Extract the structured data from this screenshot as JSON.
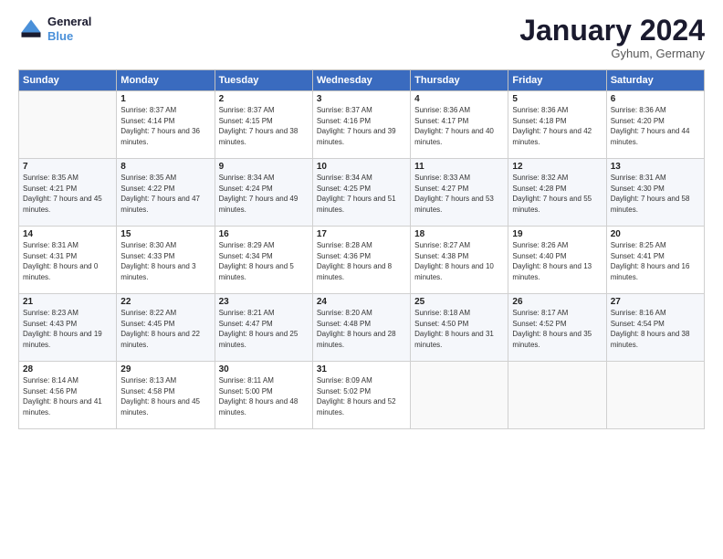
{
  "logo": {
    "line1": "General",
    "line2": "Blue"
  },
  "title": "January 2024",
  "location": "Gyhum, Germany",
  "weekdays": [
    "Sunday",
    "Monday",
    "Tuesday",
    "Wednesday",
    "Thursday",
    "Friday",
    "Saturday"
  ],
  "weeks": [
    [
      {
        "day": "",
        "sunrise": "",
        "sunset": "",
        "daylight": ""
      },
      {
        "day": "1",
        "sunrise": "Sunrise: 8:37 AM",
        "sunset": "Sunset: 4:14 PM",
        "daylight": "Daylight: 7 hours and 36 minutes."
      },
      {
        "day": "2",
        "sunrise": "Sunrise: 8:37 AM",
        "sunset": "Sunset: 4:15 PM",
        "daylight": "Daylight: 7 hours and 38 minutes."
      },
      {
        "day": "3",
        "sunrise": "Sunrise: 8:37 AM",
        "sunset": "Sunset: 4:16 PM",
        "daylight": "Daylight: 7 hours and 39 minutes."
      },
      {
        "day": "4",
        "sunrise": "Sunrise: 8:36 AM",
        "sunset": "Sunset: 4:17 PM",
        "daylight": "Daylight: 7 hours and 40 minutes."
      },
      {
        "day": "5",
        "sunrise": "Sunrise: 8:36 AM",
        "sunset": "Sunset: 4:18 PM",
        "daylight": "Daylight: 7 hours and 42 minutes."
      },
      {
        "day": "6",
        "sunrise": "Sunrise: 8:36 AM",
        "sunset": "Sunset: 4:20 PM",
        "daylight": "Daylight: 7 hours and 44 minutes."
      }
    ],
    [
      {
        "day": "7",
        "sunrise": "Sunrise: 8:35 AM",
        "sunset": "Sunset: 4:21 PM",
        "daylight": "Daylight: 7 hours and 45 minutes."
      },
      {
        "day": "8",
        "sunrise": "Sunrise: 8:35 AM",
        "sunset": "Sunset: 4:22 PM",
        "daylight": "Daylight: 7 hours and 47 minutes."
      },
      {
        "day": "9",
        "sunrise": "Sunrise: 8:34 AM",
        "sunset": "Sunset: 4:24 PM",
        "daylight": "Daylight: 7 hours and 49 minutes."
      },
      {
        "day": "10",
        "sunrise": "Sunrise: 8:34 AM",
        "sunset": "Sunset: 4:25 PM",
        "daylight": "Daylight: 7 hours and 51 minutes."
      },
      {
        "day": "11",
        "sunrise": "Sunrise: 8:33 AM",
        "sunset": "Sunset: 4:27 PM",
        "daylight": "Daylight: 7 hours and 53 minutes."
      },
      {
        "day": "12",
        "sunrise": "Sunrise: 8:32 AM",
        "sunset": "Sunset: 4:28 PM",
        "daylight": "Daylight: 7 hours and 55 minutes."
      },
      {
        "day": "13",
        "sunrise": "Sunrise: 8:31 AM",
        "sunset": "Sunset: 4:30 PM",
        "daylight": "Daylight: 7 hours and 58 minutes."
      }
    ],
    [
      {
        "day": "14",
        "sunrise": "Sunrise: 8:31 AM",
        "sunset": "Sunset: 4:31 PM",
        "daylight": "Daylight: 8 hours and 0 minutes."
      },
      {
        "day": "15",
        "sunrise": "Sunrise: 8:30 AM",
        "sunset": "Sunset: 4:33 PM",
        "daylight": "Daylight: 8 hours and 3 minutes."
      },
      {
        "day": "16",
        "sunrise": "Sunrise: 8:29 AM",
        "sunset": "Sunset: 4:34 PM",
        "daylight": "Daylight: 8 hours and 5 minutes."
      },
      {
        "day": "17",
        "sunrise": "Sunrise: 8:28 AM",
        "sunset": "Sunset: 4:36 PM",
        "daylight": "Daylight: 8 hours and 8 minutes."
      },
      {
        "day": "18",
        "sunrise": "Sunrise: 8:27 AM",
        "sunset": "Sunset: 4:38 PM",
        "daylight": "Daylight: 8 hours and 10 minutes."
      },
      {
        "day": "19",
        "sunrise": "Sunrise: 8:26 AM",
        "sunset": "Sunset: 4:40 PM",
        "daylight": "Daylight: 8 hours and 13 minutes."
      },
      {
        "day": "20",
        "sunrise": "Sunrise: 8:25 AM",
        "sunset": "Sunset: 4:41 PM",
        "daylight": "Daylight: 8 hours and 16 minutes."
      }
    ],
    [
      {
        "day": "21",
        "sunrise": "Sunrise: 8:23 AM",
        "sunset": "Sunset: 4:43 PM",
        "daylight": "Daylight: 8 hours and 19 minutes."
      },
      {
        "day": "22",
        "sunrise": "Sunrise: 8:22 AM",
        "sunset": "Sunset: 4:45 PM",
        "daylight": "Daylight: 8 hours and 22 minutes."
      },
      {
        "day": "23",
        "sunrise": "Sunrise: 8:21 AM",
        "sunset": "Sunset: 4:47 PM",
        "daylight": "Daylight: 8 hours and 25 minutes."
      },
      {
        "day": "24",
        "sunrise": "Sunrise: 8:20 AM",
        "sunset": "Sunset: 4:48 PM",
        "daylight": "Daylight: 8 hours and 28 minutes."
      },
      {
        "day": "25",
        "sunrise": "Sunrise: 8:18 AM",
        "sunset": "Sunset: 4:50 PM",
        "daylight": "Daylight: 8 hours and 31 minutes."
      },
      {
        "day": "26",
        "sunrise": "Sunrise: 8:17 AM",
        "sunset": "Sunset: 4:52 PM",
        "daylight": "Daylight: 8 hours and 35 minutes."
      },
      {
        "day": "27",
        "sunrise": "Sunrise: 8:16 AM",
        "sunset": "Sunset: 4:54 PM",
        "daylight": "Daylight: 8 hours and 38 minutes."
      }
    ],
    [
      {
        "day": "28",
        "sunrise": "Sunrise: 8:14 AM",
        "sunset": "Sunset: 4:56 PM",
        "daylight": "Daylight: 8 hours and 41 minutes."
      },
      {
        "day": "29",
        "sunrise": "Sunrise: 8:13 AM",
        "sunset": "Sunset: 4:58 PM",
        "daylight": "Daylight: 8 hours and 45 minutes."
      },
      {
        "day": "30",
        "sunrise": "Sunrise: 8:11 AM",
        "sunset": "Sunset: 5:00 PM",
        "daylight": "Daylight: 8 hours and 48 minutes."
      },
      {
        "day": "31",
        "sunrise": "Sunrise: 8:09 AM",
        "sunset": "Sunset: 5:02 PM",
        "daylight": "Daylight: 8 hours and 52 minutes."
      },
      {
        "day": "",
        "sunrise": "",
        "sunset": "",
        "daylight": ""
      },
      {
        "day": "",
        "sunrise": "",
        "sunset": "",
        "daylight": ""
      },
      {
        "day": "",
        "sunrise": "",
        "sunset": "",
        "daylight": ""
      }
    ]
  ]
}
